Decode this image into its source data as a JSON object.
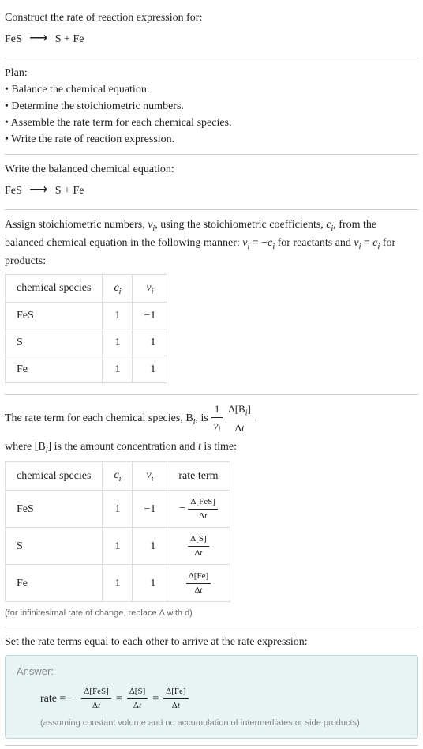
{
  "intro": {
    "title": "Construct the rate of reaction expression for:",
    "reactant": "FeS",
    "product1": "S",
    "product2": "Fe"
  },
  "plan": {
    "heading": "Plan:",
    "items": [
      "• Balance the chemical equation.",
      "• Determine the stoichiometric numbers.",
      "• Assemble the rate term for each chemical species.",
      "• Write the rate of reaction expression."
    ]
  },
  "balanced": {
    "text": "Write the balanced chemical equation:",
    "reactant": "FeS",
    "product1": "S",
    "product2": "Fe"
  },
  "assign": {
    "text1": "Assign stoichiometric numbers, ",
    "nu_i": "ν",
    "sub_i": "i",
    "text2": ", using the stoichiometric coefficients, ",
    "c_i": "c",
    "text3": ", from the balanced chemical equation in the following manner: ",
    "eq_reactants": " for reactants and ",
    "eq_products": " for products:",
    "neg": "−",
    "eq": " = "
  },
  "table1": {
    "headers": [
      "chemical species",
      "c",
      "ν"
    ],
    "sub": "i",
    "rows": [
      {
        "species": "FeS",
        "c": "1",
        "nu": "−1"
      },
      {
        "species": "S",
        "c": "1",
        "nu": "1"
      },
      {
        "species": "Fe",
        "c": "1",
        "nu": "1"
      }
    ]
  },
  "rateterm": {
    "text1": "The rate term for each chemical species, B",
    "sub_i": "i",
    "text2": ", is ",
    "text3": " where [B",
    "text4": "] is the amount concentration and ",
    "t": "t",
    "text5": " is time:",
    "frac1_num": "1",
    "frac1_den_nu": "ν",
    "frac2_num": "Δ[B",
    "frac2_num2": "]",
    "frac2_den": "Δt"
  },
  "table2": {
    "headers": [
      "chemical species",
      "c",
      "ν",
      "rate term"
    ],
    "sub": "i",
    "rows": [
      {
        "species": "FeS",
        "c": "1",
        "nu": "−1",
        "sign": "−",
        "conc": "Δ[FeS]",
        "dt": "Δt"
      },
      {
        "species": "S",
        "c": "1",
        "nu": "1",
        "sign": "",
        "conc": "Δ[S]",
        "dt": "Δt"
      },
      {
        "species": "Fe",
        "c": "1",
        "nu": "1",
        "sign": "",
        "conc": "Δ[Fe]",
        "dt": "Δt"
      }
    ],
    "note": "(for infinitesimal rate of change, replace Δ with d)"
  },
  "final": {
    "text": "Set the rate terms equal to each other to arrive at the rate expression:"
  },
  "answer": {
    "label": "Answer:",
    "rate": "rate = ",
    "neg": "−",
    "eq": " = ",
    "fes_num": "Δ[FeS]",
    "s_num": "Δ[S]",
    "fe_num": "Δ[Fe]",
    "dt": "Δt",
    "note": "(assuming constant volume and no accumulation of intermediates or side products)"
  }
}
